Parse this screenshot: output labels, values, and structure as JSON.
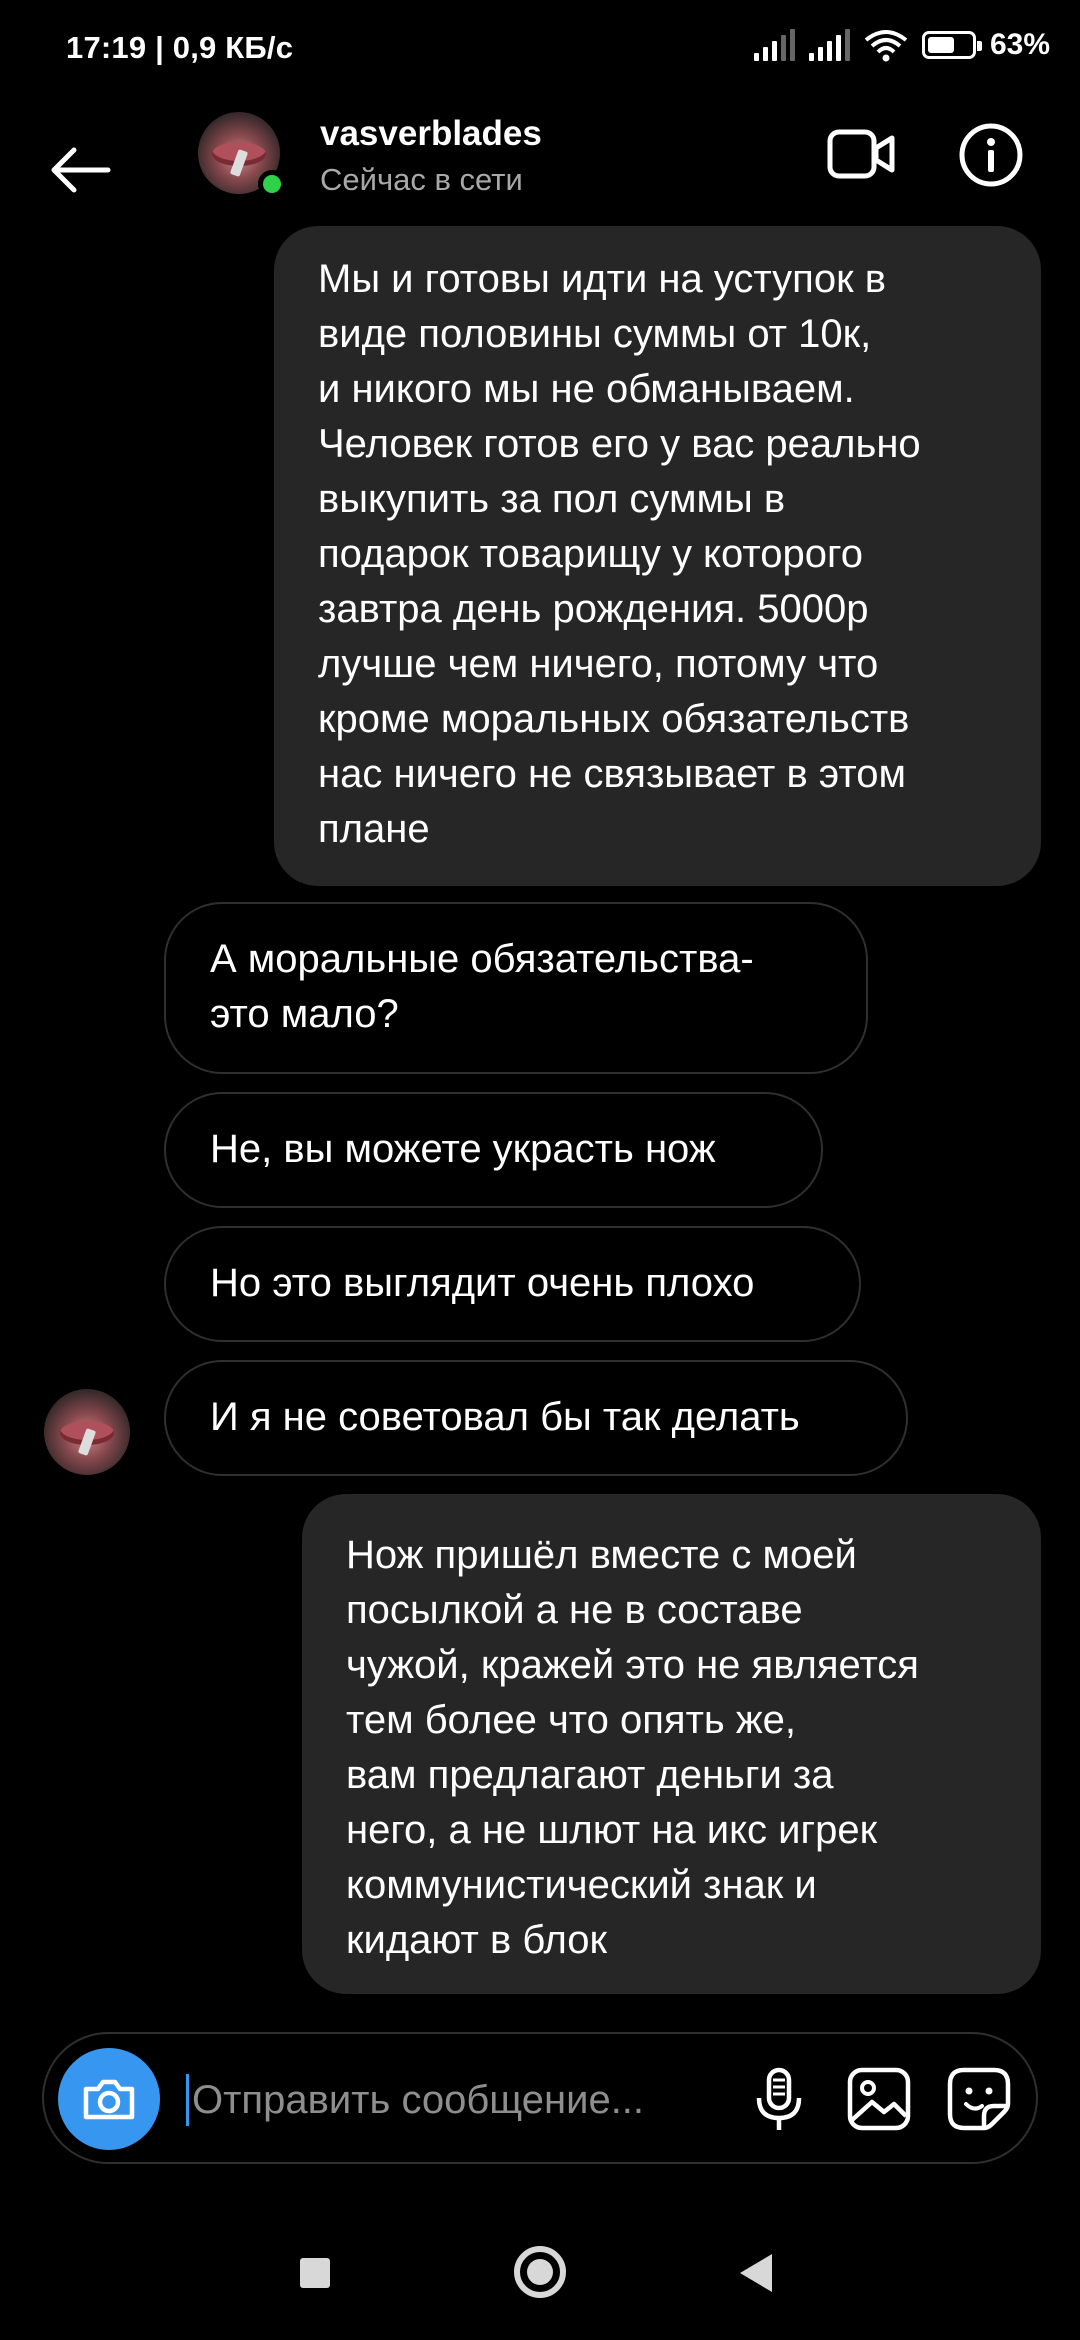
{
  "status_bar": {
    "time_speed": "17:19 | 0,9 КБ/с",
    "battery_percent": "63",
    "battery_level": 0.63
  },
  "header": {
    "back_icon": "arrow-left-icon",
    "contact_name": "vasverblades",
    "contact_status": "Сейчас в сети",
    "online_color": "#2fd14a",
    "video_icon": "video-camera-icon",
    "info_icon": "info-icon"
  },
  "messages": [
    {
      "direction": "sent",
      "text": "Мы и готовы идти на уступок в\nвиде половины суммы от 10к,\nи никого мы не обманываем.\nЧеловек готов его у вас реально\nвыкупить за пол суммы в\nподарок товарищу у которого\nзавтра день рождения. 5000р\nлучше чем ничего, потому что\nкроме моральных обязательств\nнас ничего не связывает в этом\nплане"
    },
    {
      "direction": "received",
      "text": "А моральные обязательства-\nэто мало?"
    },
    {
      "direction": "received",
      "text": "Не, вы можете украсть нож"
    },
    {
      "direction": "received",
      "text": "Но это выглядит очень плохо"
    },
    {
      "direction": "received",
      "text": "И я не советовал бы так делать"
    },
    {
      "direction": "sent",
      "text": "Нож пришёл вместе с моей\nпосылкой а не в составе\nчужой, кражей это не является\nтем более что опять же,\nвам предлагают деньги за\nнего, а не шлют на икс игрек\nкоммунистический знак и\nкидают в блок"
    }
  ],
  "composer": {
    "placeholder": "Отправить сообщение...",
    "accent_color": "#3797f0",
    "camera_icon": "camera-icon",
    "mic_icon": "microphone-icon",
    "gallery_icon": "image-icon",
    "sticker_icon": "sticker-icon"
  },
  "nav_bar": {
    "recents_icon": "square-icon",
    "home_icon": "circle-icon",
    "back_icon": "triangle-back-icon"
  },
  "colors": {
    "background": "#000000",
    "sent_bubble": "#262626",
    "received_border": "#2f2f2f",
    "secondary_text": "#a8a8a8"
  }
}
